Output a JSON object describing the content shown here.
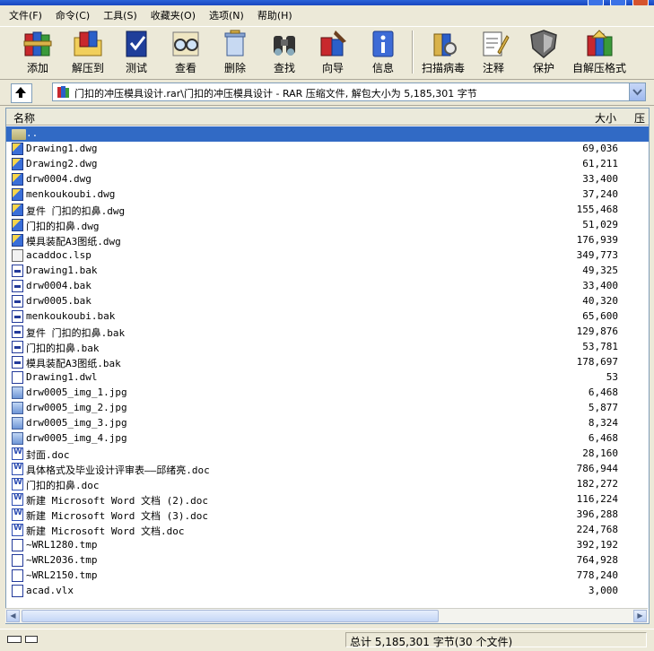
{
  "menu": [
    "文件(F)",
    "命令(C)",
    "工具(S)",
    "收藏夹(O)",
    "选项(N)",
    "帮助(H)"
  ],
  "toolbar": [
    {
      "label": "添加",
      "icon": "books-add-icon"
    },
    {
      "label": "解压到",
      "icon": "extract-folder-icon"
    },
    {
      "label": "测试",
      "icon": "test-book-icon"
    },
    {
      "label": "查看",
      "icon": "view-glasses-icon"
    },
    {
      "label": "删除",
      "icon": "delete-icon"
    },
    {
      "label": "查找",
      "icon": "binoculars-icon"
    },
    {
      "label": "向导",
      "icon": "wizard-icon"
    },
    {
      "label": "信息",
      "icon": "info-icon"
    },
    {
      "label": "扫描病毒",
      "icon": "virus-scan-icon"
    },
    {
      "label": "注释",
      "icon": "comment-icon"
    },
    {
      "label": "保护",
      "icon": "shield-icon"
    },
    {
      "label": "自解压格式",
      "icon": "sfx-icon"
    }
  ],
  "address": {
    "text": "门扣的冲压模具设计.rar\\门扣的冲压模具设计 - RAR 压缩文件, 解包大小为 5,185,301 字节"
  },
  "columns": {
    "name": "名称",
    "size": "大小",
    "packed": "压"
  },
  "files": [
    {
      "name": "..",
      "size": "",
      "type": "folder",
      "selected": true
    },
    {
      "name": "Drawing1.dwg",
      "size": "69,036",
      "type": "dwg"
    },
    {
      "name": "Drawing2.dwg",
      "size": "61,211",
      "type": "dwg"
    },
    {
      "name": "drw0004.dwg",
      "size": "33,400",
      "type": "dwg"
    },
    {
      "name": "menkoukoubi.dwg",
      "size": "37,240",
      "type": "dwg"
    },
    {
      "name": "复件 门扣的扣鼻.dwg",
      "size": "155,468",
      "type": "dwg"
    },
    {
      "name": "门扣的扣鼻.dwg",
      "size": "51,029",
      "type": "dwg"
    },
    {
      "name": "模具装配A3图纸.dwg",
      "size": "176,939",
      "type": "dwg"
    },
    {
      "name": "acaddoc.lsp",
      "size": "349,773",
      "type": "lsp"
    },
    {
      "name": "Drawing1.bak",
      "size": "49,325",
      "type": "bak"
    },
    {
      "name": "drw0004.bak",
      "size": "33,400",
      "type": "bak"
    },
    {
      "name": "drw0005.bak",
      "size": "40,320",
      "type": "bak"
    },
    {
      "name": "menkoukoubi.bak",
      "size": "65,600",
      "type": "bak"
    },
    {
      "name": "复件 门扣的扣鼻.bak",
      "size": "129,876",
      "type": "bak"
    },
    {
      "name": "门扣的扣鼻.bak",
      "size": "53,781",
      "type": "bak"
    },
    {
      "name": "模具装配A3图纸.bak",
      "size": "178,697",
      "type": "bak"
    },
    {
      "name": "Drawing1.dwl",
      "size": "53",
      "type": "dwl"
    },
    {
      "name": "drw0005_img_1.jpg",
      "size": "6,468",
      "type": "jpg"
    },
    {
      "name": "drw0005_img_2.jpg",
      "size": "5,877",
      "type": "jpg"
    },
    {
      "name": "drw0005_img_3.jpg",
      "size": "8,324",
      "type": "jpg"
    },
    {
      "name": "drw0005_img_4.jpg",
      "size": "6,468",
      "type": "jpg"
    },
    {
      "name": "封面.doc",
      "size": "28,160",
      "type": "doc"
    },
    {
      "name": "具体格式及毕业设计评审表——邱绪亮.doc",
      "size": "786,944",
      "type": "doc"
    },
    {
      "name": "门扣的扣鼻.doc",
      "size": "182,272",
      "type": "doc"
    },
    {
      "name": "新建 Microsoft Word 文档 (2).doc",
      "size": "116,224",
      "type": "doc"
    },
    {
      "name": "新建 Microsoft Word 文档 (3).doc",
      "size": "396,288",
      "type": "doc"
    },
    {
      "name": "新建 Microsoft Word 文档.doc",
      "size": "224,768",
      "type": "doc"
    },
    {
      "name": "~WRL1280.tmp",
      "size": "392,192",
      "type": "tmp"
    },
    {
      "name": "~WRL2036.tmp",
      "size": "764,928",
      "type": "tmp"
    },
    {
      "name": "~WRL2150.tmp",
      "size": "778,240",
      "type": "tmp"
    },
    {
      "name": "acad.vlx",
      "size": "3,000",
      "type": "vlx"
    }
  ],
  "status": {
    "text": "总计 5,185,301 字节(30 个文件)"
  },
  "colors": {
    "selection": "#316ac5",
    "window_bg": "#ece9d8",
    "title_blue": "#2a63d8"
  }
}
